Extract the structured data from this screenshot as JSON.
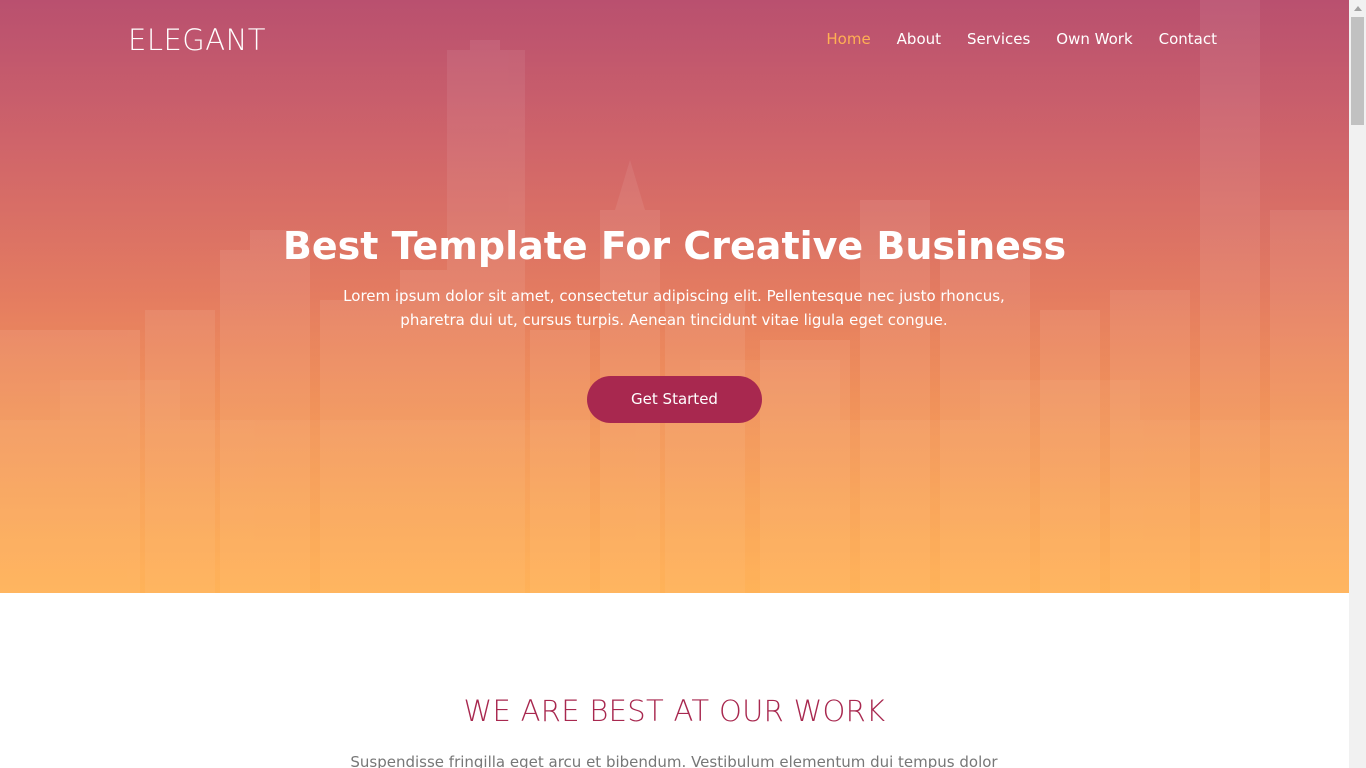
{
  "brand": {
    "logo": "ELEGANT"
  },
  "nav": {
    "items": [
      {
        "label": "Home",
        "active": true
      },
      {
        "label": "About",
        "active": false
      },
      {
        "label": "Services",
        "active": false
      },
      {
        "label": "Own Work",
        "active": false
      },
      {
        "label": "Contact",
        "active": false
      }
    ]
  },
  "hero": {
    "title": "Best Template For Creative Business",
    "text": "Lorem ipsum dolor sit amet, consectetur adipiscing elit. Pellentesque nec justo rhoncus, pharetra dui ut, cursus turpis. Aenean tincidunt vitae ligula eget congue.",
    "cta_label": "Get Started"
  },
  "section": {
    "title": "WE ARE BEST AT OUR WORK",
    "text": "Suspendisse fringilla eget arcu et bibendum. Vestibulum elementum dui tempus dolor"
  },
  "colors": {
    "accent": "#ffb054",
    "brand": "#a8284f",
    "hero_top": "#b9506f",
    "hero_bottom": "#ffb054"
  }
}
